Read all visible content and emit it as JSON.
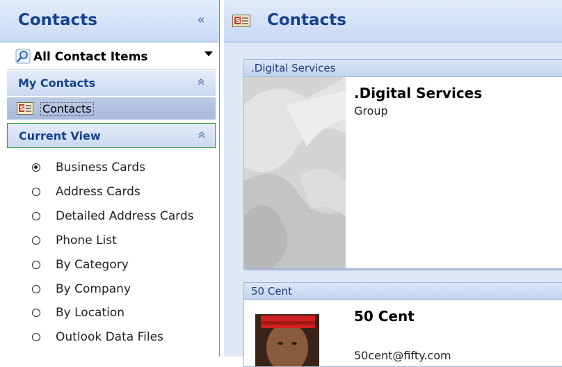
{
  "nav": {
    "title": "Contacts",
    "collapse_glyph": "«",
    "folder_select": {
      "icon": "search-icon",
      "label": "All Contact Items"
    },
    "my_contacts": {
      "title": "My Contacts",
      "collapse_glyph": "⌃",
      "items": [
        {
          "label": "Contacts",
          "icon": "contact-card-icon"
        }
      ]
    },
    "current_view": {
      "title": "Current View",
      "collapse_glyph": "⌃",
      "selected": "Business Cards",
      "options": [
        "Business Cards",
        "Address Cards",
        "Detailed Address Cards",
        "Phone List",
        "By Category",
        "By Company",
        "By Location",
        "Outlook Data Files"
      ]
    }
  },
  "main": {
    "title": "Contacts",
    "icon": "contact-card-icon",
    "cards": [
      {
        "header": ".Digital Services",
        "name": ".Digital Services",
        "subtitle": "Group",
        "image": "group-placeholder-image"
      },
      {
        "header": "50 Cent",
        "name": "50 Cent",
        "subtitle": "50cent@fifty.com",
        "image": "contact-photo"
      }
    ]
  },
  "colors": {
    "header_text": "#15428b",
    "pane_gradient_top": "#e2ecfb",
    "pane_gradient_bottom": "#c9dbf5",
    "selected_item_bg": "#b4c5e2",
    "focus_border": "#3c9a3c",
    "cards_bg": "#dfe8f6"
  }
}
